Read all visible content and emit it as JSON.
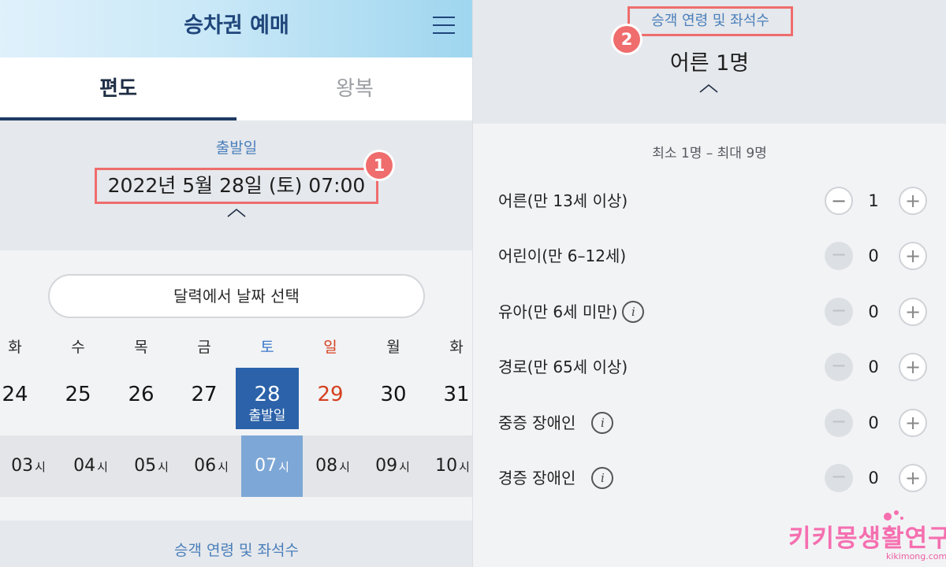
{
  "left": {
    "header": {
      "title": "승차권 예매",
      "menu_icon": "hamburger-menu-icon"
    },
    "tabs": [
      {
        "label": "편도",
        "active": true
      },
      {
        "label": "왕복",
        "active": false
      }
    ],
    "departure": {
      "label": "출발일",
      "value": "2022년 5월 28일 (토) 07:00",
      "badge": "1"
    },
    "calendar_button": "달력에서 날짜 선택",
    "weekdays": [
      "화",
      "수",
      "목",
      "금",
      "토",
      "일",
      "월",
      "화"
    ],
    "days": [
      {
        "num": "24"
      },
      {
        "num": "25"
      },
      {
        "num": "26"
      },
      {
        "num": "27"
      },
      {
        "num": "28",
        "sub": "출발일"
      },
      {
        "num": "29"
      },
      {
        "num": "30"
      },
      {
        "num": "31"
      }
    ],
    "hours": [
      {
        "num": "03",
        "unit": "시"
      },
      {
        "num": "04",
        "unit": "시"
      },
      {
        "num": "05",
        "unit": "시"
      },
      {
        "num": "06",
        "unit": "시"
      },
      {
        "num": "07",
        "unit": "시"
      },
      {
        "num": "08",
        "unit": "시"
      },
      {
        "num": "09",
        "unit": "시"
      },
      {
        "num": "10",
        "unit": "시"
      }
    ],
    "bottom_label": "승객 연령 및 좌석수"
  },
  "right": {
    "title": "승객 연령 및 좌석수",
    "badge": "2",
    "summary": "어른 1명",
    "range": "최소 1명 – 최대 9명",
    "passengers": [
      {
        "label": "어른(만 13세 이상)",
        "count": "1"
      },
      {
        "label": "어린이(만 6–12세)",
        "count": "0"
      },
      {
        "label": "유아(만 6세 미만)",
        "count": "0"
      },
      {
        "label": "경로(만 65세 이상)",
        "count": "0"
      },
      {
        "label": "중증 장애인",
        "count": "0"
      },
      {
        "label": "경증 장애인",
        "count": "0"
      }
    ],
    "minus_symbol": "−",
    "plus_symbol": "+",
    "info_symbol": "i"
  },
  "watermark": {
    "main": "키키몽생활연구소",
    "sub": "kikimong.com"
  },
  "colors": {
    "accent_blue": "#2b62a9",
    "link_blue": "#4a7fbb",
    "sunday_red": "#d4401f",
    "saturday_blue": "#3b79c9",
    "highlight_red": "#ef6d6d",
    "watermark_pink": "#f56fb0"
  }
}
